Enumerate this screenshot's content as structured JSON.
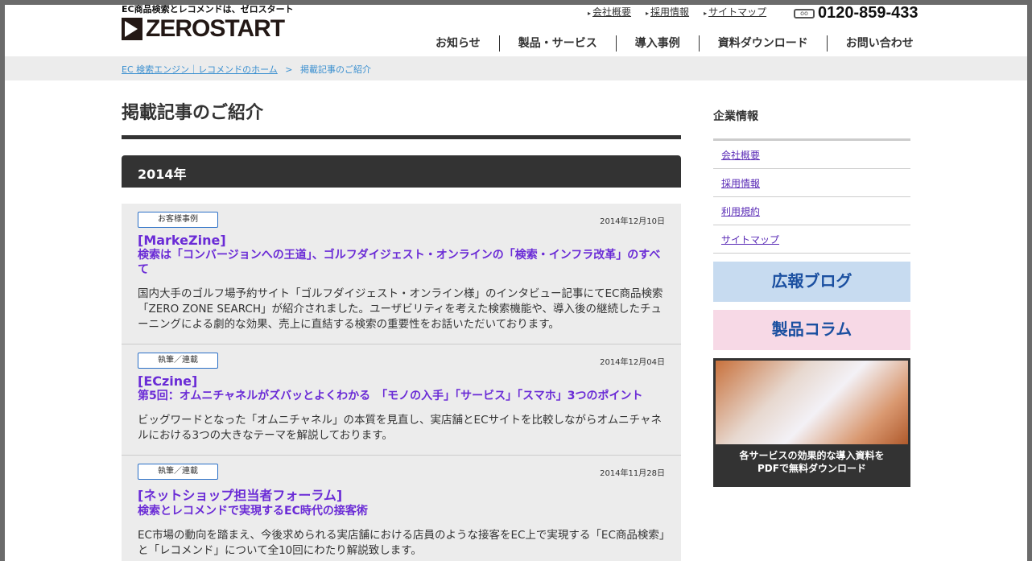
{
  "header": {
    "tagline": "EC商品検索とレコメンドは、ゼロスタート",
    "logo": "ZEROSTART",
    "top_links": [
      "会社概要",
      "採用情報",
      "サイトマップ"
    ],
    "phone": "0120-859-433",
    "freedial": "oo",
    "nav": [
      "お知らせ",
      "製品・サービス",
      "導入事例",
      "資料ダウンロード",
      "お問い合わせ"
    ]
  },
  "breadcrumb": {
    "home": "EC 検索エンジン｜レコメンドのホーム",
    "sep": ">",
    "current": "掲載記事のご紹介"
  },
  "main": {
    "title": "掲載記事のご紹介",
    "year": "2014年",
    "articles": [
      {
        "badge": "お客様事例",
        "date": "2014年12月10日",
        "source": "[MarkeZine]",
        "title": "検索は「コンバージョンへの王道」、ゴルフダイジェスト・オンラインの「検索・インフラ改革」のすべて",
        "desc": "国内大手のゴルフ場予約サイト「ゴルフダイジェスト・オンライン様」のインタビュー記事にてEC商品検索「ZERO ZONE SEARCH」が紹介されました。ユーザビリティを考えた検索機能や、導入後の継続したチューニングによる劇的な効果、売上に直結する検索の重要性をお話いただいております。"
      },
      {
        "badge": "執筆／連載",
        "date": "2014年12月04日",
        "source": "[ECzine]",
        "title": "第5回：オムニチャネルがズバッとよくわかる　「モノの入手」「サービス」「スマホ」3つのポイント",
        "desc": "ビッグワードとなった「オムニチャネル」の本質を見直し、実店舗とECサイトを比較しながらオムニチャネルにおける3つの大きなテーマを解説しております。"
      },
      {
        "badge": "執筆／連載",
        "date": "2014年11月28日",
        "source": "[ネットショップ担当者フォーラム]",
        "title": "検索とレコメンドで実現するEC時代の接客術",
        "desc": "EC市場の動向を踏まえ、今後求められる実店舗における店員のような接客をEC上で実現する「EC商品検索」と「レコメンド」について全10回にわたり解説致します。"
      }
    ]
  },
  "sidebar": {
    "heading": "企業情報",
    "links": [
      "会社概要",
      "採用情報",
      "利用規約",
      "サイトマップ"
    ],
    "banner_blog": "広報ブログ",
    "banner_column": "製品コラム",
    "download_text": [
      "各サービスの効果的な導入資料を",
      "PDFで無料ダウンロード"
    ]
  }
}
